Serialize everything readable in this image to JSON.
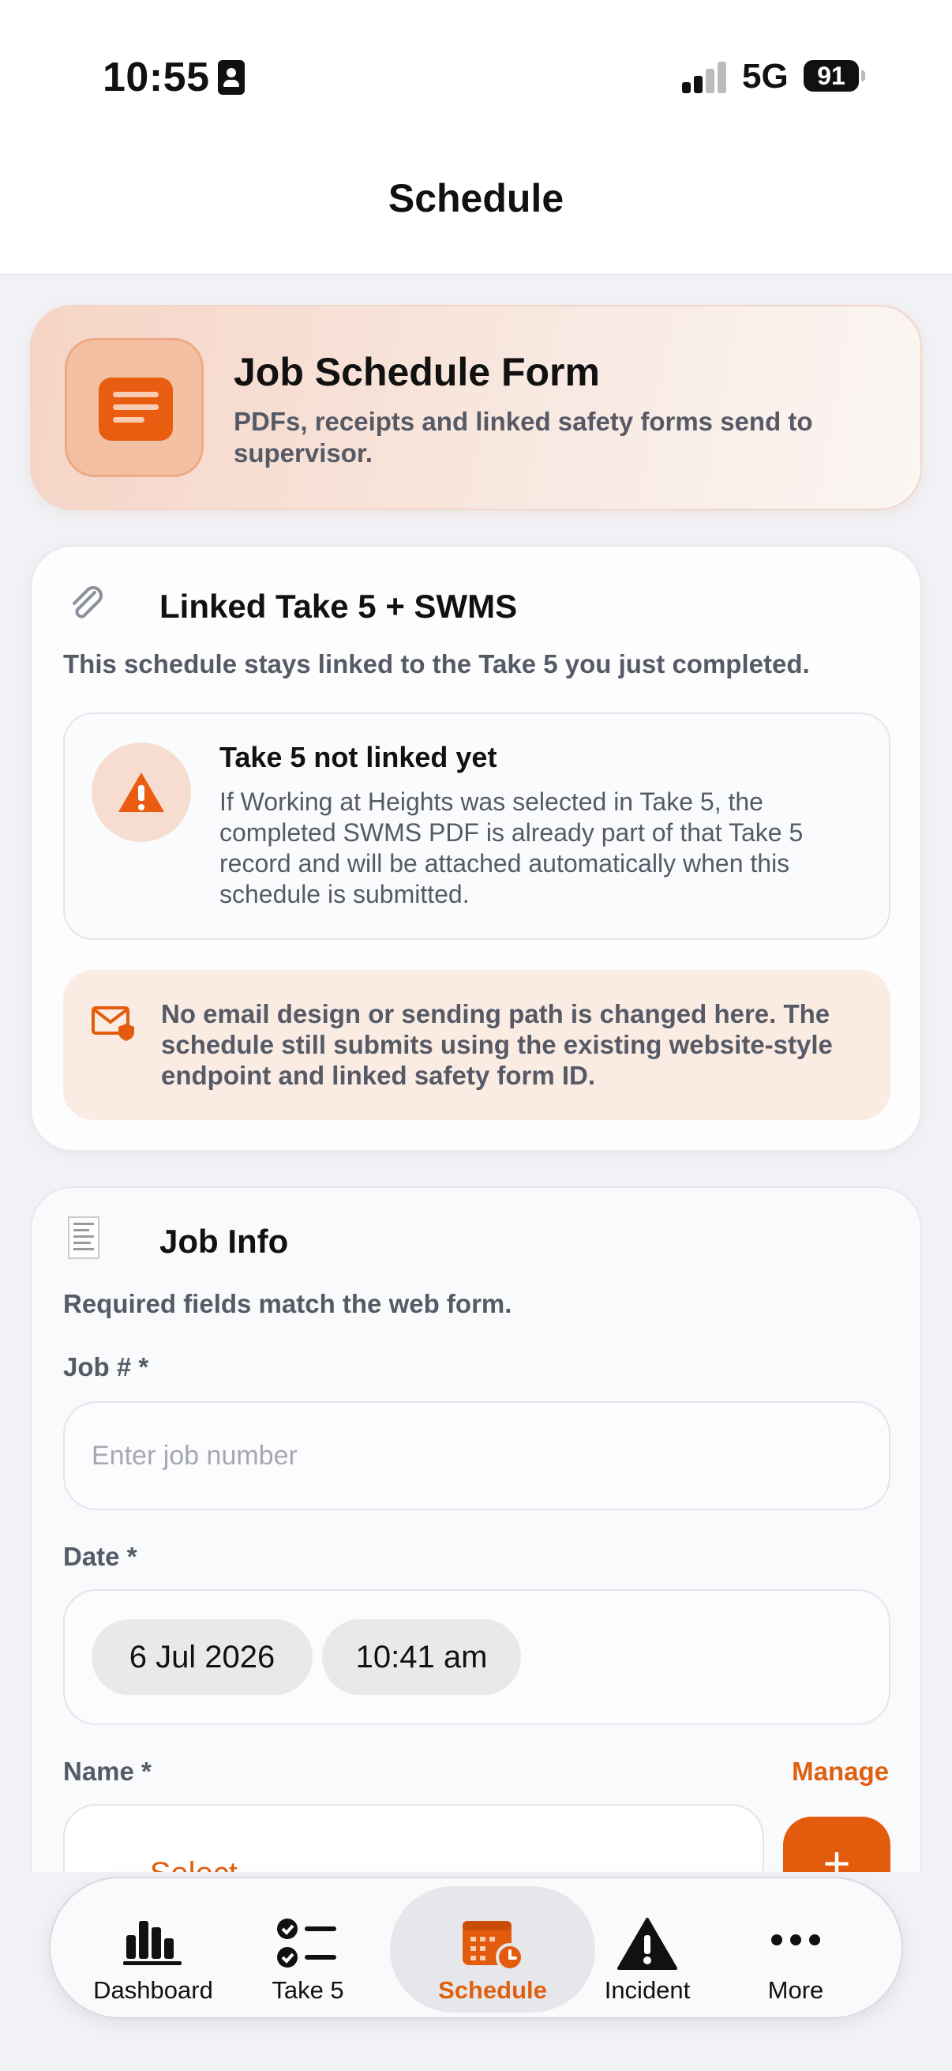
{
  "status_bar": {
    "time": "10:55",
    "network": "5G",
    "battery": "91"
  },
  "header": {
    "title": "Schedule"
  },
  "hero": {
    "title": "Job Schedule Form",
    "subtitle": "PDFs, receipts and linked safety forms send to supervisor.",
    "icon": "document-icon"
  },
  "linked": {
    "title": "Linked Take 5 + SWMS",
    "description": "This schedule stays linked to the Take 5 you just completed.",
    "notice_title": "Take 5 not linked yet",
    "notice_body": "If Working at Heights was selected in Take 5, the completed SWMS PDF is already part of that Take 5 record and will be attached automatically when this schedule is submitted.",
    "email_note": "No email design or sending path is changed here. The schedule still submits using the existing website-style endpoint and linked safety form ID."
  },
  "job_info": {
    "title": "Job Info",
    "description": "Required fields match the web form.",
    "job_label": "Job # *",
    "job_placeholder": "Enter job number",
    "date_label": "Date *",
    "date_value": "6 Jul 2026",
    "time_value": "10:41 am",
    "name_label": "Name *",
    "manage_label": "Manage",
    "select_value": "-- Select --",
    "add_label": "+"
  },
  "tabs": [
    {
      "label": "Dashboard",
      "icon": "bar-chart-icon",
      "active": false
    },
    {
      "label": "Take 5",
      "icon": "checklist-icon",
      "active": false
    },
    {
      "label": "Schedule",
      "icon": "calendar-clock-icon",
      "active": true
    },
    {
      "label": "Incident",
      "icon": "warning-icon",
      "active": false
    },
    {
      "label": "More",
      "icon": "more-icon",
      "active": false
    }
  ],
  "colors": {
    "accent": "#E35B0C",
    "text_secondary": "#555A66",
    "background": "#F1F2F6"
  }
}
